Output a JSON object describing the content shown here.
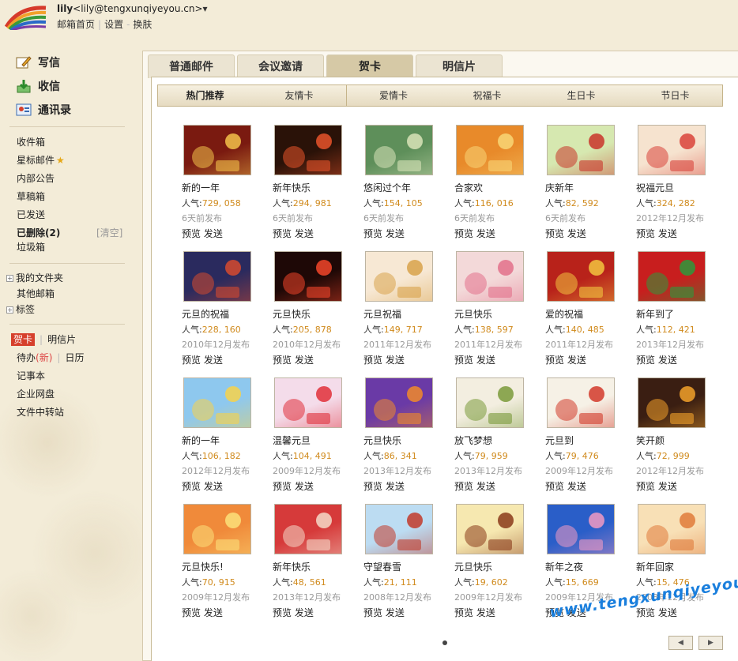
{
  "header": {
    "username": "lily",
    "email": "<lily@tengxunqiyeyou.cn>",
    "dropdown": "▾",
    "links": [
      "邮箱首页",
      "设置",
      "换肤"
    ],
    "separators": [
      "|",
      "-"
    ]
  },
  "sidebar": {
    "main_actions": [
      {
        "label": "写信",
        "icon": "write-icon"
      },
      {
        "label": "收信",
        "icon": "inbox-download-icon"
      },
      {
        "label": "通讯录",
        "icon": "contacts-icon"
      }
    ],
    "folders": [
      {
        "label": "收件箱"
      },
      {
        "label": "星标邮件",
        "star": "★"
      },
      {
        "label": "内部公告"
      },
      {
        "label": "草稿箱"
      },
      {
        "label": "已发送"
      },
      {
        "label": "已删除(2)",
        "action": "[清空]"
      },
      {
        "label": "垃圾箱"
      }
    ],
    "tree": [
      {
        "label": "我的文件夹",
        "expand": "+"
      },
      {
        "label": "其他邮箱"
      },
      {
        "label": "标签",
        "expand": "+"
      }
    ],
    "tools": {
      "cards": "贺卡",
      "postcards": "明信片",
      "todo": "待办",
      "todo_badge": "(新)",
      "calendar": "日历",
      "notes": "记事本",
      "netdisk": "企业网盘",
      "transfer": "文件中转站",
      "sep": "|"
    }
  },
  "tabs": [
    "普通邮件",
    "会议邀请",
    "贺卡",
    "明信片"
  ],
  "active_tab": 2,
  "subtabs": [
    "热门推荐",
    "友情卡",
    "爱情卡",
    "祝福卡",
    "生日卡",
    "节日卡"
  ],
  "card_labels": {
    "pop": "人气:",
    "preview": "预览",
    "send": "发送"
  },
  "cards": [
    {
      "title": "新的一年",
      "pop": "729, 058",
      "date": "6天前发布",
      "bg": "#7a1a10",
      "fg": "#f3c24a"
    },
    {
      "title": "新年快乐",
      "pop": "294, 981",
      "date": "6天前发布",
      "bg": "#2a1208",
      "fg": "#e8532a"
    },
    {
      "title": "悠闲过个年",
      "pop": "154, 105",
      "date": "6天前发布",
      "bg": "#5e8f5a",
      "fg": "#d9e4b9"
    },
    {
      "title": "合家欢",
      "pop": "116, 016",
      "date": "6天前发布",
      "bg": "#e88a2a",
      "fg": "#f8d676"
    },
    {
      "title": "庆新年",
      "pop": "82, 592",
      "date": "6天前发布",
      "bg": "#d6e8b0",
      "fg": "#c9342a"
    },
    {
      "title": "祝福元旦",
      "pop": "324, 282",
      "date": "2012年12月发布",
      "bg": "#f6e3cf",
      "fg": "#d9433a"
    },
    {
      "title": "元旦的祝福",
      "pop": "228, 160",
      "date": "2010年12月发布",
      "bg": "#2a2a5e",
      "fg": "#d64a2e"
    },
    {
      "title": "元旦快乐",
      "pop": "205, 878",
      "date": "2010年12月发布",
      "bg": "#1e0806",
      "fg": "#f2452a"
    },
    {
      "title": "元旦祝福",
      "pop": "149, 717",
      "date": "2011年12月发布",
      "bg": "#f7e8d4",
      "fg": "#d8a24a"
    },
    {
      "title": "元旦快乐",
      "pop": "138, 597",
      "date": "2011年12月发布",
      "bg": "#f3d9d9",
      "fg": "#e2708a"
    },
    {
      "title": "爱的祝福",
      "pop": "140, 485",
      "date": "2011年12月发布",
      "bg": "#b8221a",
      "fg": "#f2c440"
    },
    {
      "title": "新年到了",
      "pop": "112, 421",
      "date": "2013年12月发布",
      "bg": "#c81e1e",
      "fg": "#2c9a3c"
    },
    {
      "title": "新的一年",
      "pop": "106, 182",
      "date": "2012年12月发布",
      "bg": "#8ec8ee",
      "fg": "#f7d24a"
    },
    {
      "title": "温馨元旦",
      "pop": "104, 491",
      "date": "2009年12月发布",
      "bg": "#f4dcea",
      "fg": "#e0303a"
    },
    {
      "title": "元旦快乐",
      "pop": "86, 341",
      "date": "2013年12月发布",
      "bg": "#6a3aa6",
      "fg": "#f08a2a"
    },
    {
      "title": "放飞梦想",
      "pop": "79, 959",
      "date": "2013年12月发布",
      "bg": "#f3eee0",
      "fg": "#7a9a3a"
    },
    {
      "title": "元旦到",
      "pop": "79, 476",
      "date": "2009年12月发布",
      "bg": "#f6f1e6",
      "fg": "#d23a2a"
    },
    {
      "title": "笑开颜",
      "pop": "72, 999",
      "date": "2012年12月发布",
      "bg": "#3a1e12",
      "fg": "#f2a12a"
    },
    {
      "title": "元旦快乐!",
      "pop": "70, 915",
      "date": "2009年12月发布",
      "bg": "#f08a3a",
      "fg": "#fbe07a"
    },
    {
      "title": "新年快乐",
      "pop": "48, 561",
      "date": "2013年12月发布",
      "bg": "#d63a3a",
      "fg": "#f4d9c8"
    },
    {
      "title": "守望春雪",
      "pop": "21, 111",
      "date": "2008年12月发布",
      "bg": "#bcdcf2",
      "fg": "#c23a2a"
    },
    {
      "title": "元旦快乐",
      "pop": "19, 602",
      "date": "2009年12月发布",
      "bg": "#f6e8b0",
      "fg": "#8a3a1a"
    },
    {
      "title": "新年之夜",
      "pop": "15, 669",
      "date": "2009年12月发布",
      "bg": "#2a5ec8",
      "fg": "#f29ac2"
    },
    {
      "title": "新年回家",
      "pop": "15, 476",
      "date": "2008年12月发布",
      "bg": "#f8e0b6",
      "fg": "#e07a3a"
    }
  ],
  "pager": {
    "prev": "◀",
    "next": "▶"
  },
  "watermark": "www.tengxunqiyeyou.com"
}
